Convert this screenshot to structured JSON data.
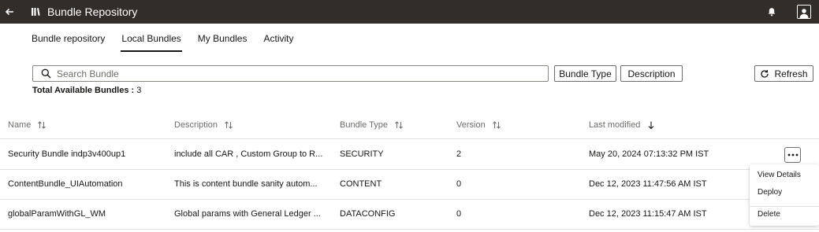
{
  "header": {
    "title": "Bundle Repository",
    "back_icon": "arrow-left-icon",
    "app_icon": "library-icon",
    "bell_icon": "bell-icon",
    "profile_icon": "user-profile-icon"
  },
  "tabs": [
    {
      "label": "Bundle repository",
      "active": false
    },
    {
      "label": "Local Bundles",
      "active": true
    },
    {
      "label": "My Bundles",
      "active": false
    },
    {
      "label": "Activity",
      "active": false
    }
  ],
  "search": {
    "placeholder": "Search Bundle",
    "value": ""
  },
  "filters": {
    "bundle_type": "Bundle Type",
    "description": "Description"
  },
  "refresh": {
    "label": "Refresh"
  },
  "total": {
    "label": "Total Available Bundles :",
    "count": "3"
  },
  "table": {
    "columns": [
      "Name",
      "Description",
      "Bundle Type",
      "Version",
      "Last modified"
    ],
    "rows": [
      {
        "name": "Security Bundle indp3v400up1",
        "description": "include all CAR , Custom Group to R...",
        "type": "SECURITY",
        "version": "2",
        "modified": "May 20, 2024 07:13:32 PM IST"
      },
      {
        "name": "ContentBundle_UIAutomation",
        "description": "This is content bundle sanity autom...",
        "type": "CONTENT",
        "version": "0",
        "modified": "Dec 12, 2023 11:47:56 AM IST"
      },
      {
        "name": "globalParamWithGL_WM",
        "description": "Global params with General Ledger ...",
        "type": "DATACONFIG",
        "version": "0",
        "modified": "Dec 12, 2023 11:15:47 AM IST"
      }
    ]
  },
  "menu": {
    "items": [
      "View Details",
      "Deploy",
      "Delete"
    ]
  },
  "colors": {
    "header_bg": "#312d2a",
    "text": "#161513",
    "muted": "#6f6c69",
    "border": "#e4e1dd"
  }
}
